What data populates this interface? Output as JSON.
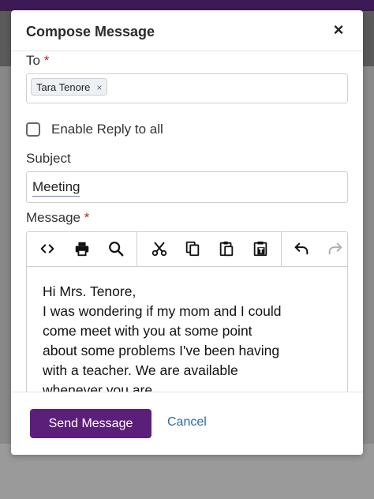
{
  "modal": {
    "title": "Compose Message",
    "close_symbol": "×"
  },
  "to_field": {
    "label": "To",
    "required_mark": "*",
    "recipients": [
      {
        "name": "Tara Tenore",
        "remove_symbol": "×"
      }
    ]
  },
  "reply_all": {
    "label": "Enable Reply to all",
    "checked": false
  },
  "subject_field": {
    "label": "Subject",
    "value": "Meeting"
  },
  "message_field": {
    "label": "Message",
    "required_mark": "*",
    "toolbar": [
      {
        "icon": "code-icon"
      },
      {
        "icon": "print-icon"
      },
      {
        "icon": "search-icon"
      },
      {
        "icon": "cut-icon"
      },
      {
        "icon": "copy-icon"
      },
      {
        "icon": "paste-icon"
      },
      {
        "icon": "paste-text-icon"
      },
      {
        "icon": "undo-icon"
      },
      {
        "icon": "redo-icon"
      }
    ],
    "body_lines": [
      "Hi Mrs. Tenore,",
      "I was wondering if my mom and I could",
      "come meet with you at some point",
      "about some problems I've been having",
      "with a teacher. We are available",
      "whenever you "
    ],
    "body_last_word": "are",
    "body_last_punct": "."
  },
  "footer": {
    "send_label": "Send Message",
    "cancel_label": "Cancel"
  },
  "colors": {
    "primary_button": "#5b1f7a",
    "link": "#2a6aa0",
    "required": "#c0202a",
    "top_bar": "#3d1a55"
  }
}
